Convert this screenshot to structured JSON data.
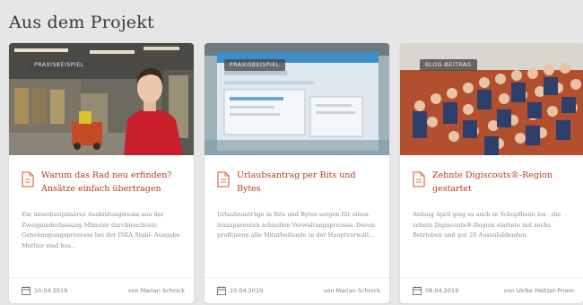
{
  "section": {
    "title": "Aus dem Projekt"
  },
  "cards": [
    {
      "badge": "Praxisbeispiel",
      "title": "Warum das Rad neu erfinden? Ansätze einfach übertragen",
      "text": "Ein interdisziplinäres Ausbildungsteam aus der Zweigniederlassung Münster durchleuchtete Genehmigungsprozesse bei der ISKA Stahl- Ausgabe Mettler sind bes…",
      "date": "10.04.2019",
      "author": "von Marian Schnick",
      "icon": "document-icon"
    },
    {
      "badge": "Praxisbeispiel",
      "title": "Urlaubsantrag per Bits und Bytes",
      "text": "Urlaubsanträge in Bits und Bytes sorgen für einen transparenten schnellen Verwaltungsprozess. Davon profitieren alle Mitarbeitende in der Hauptverwalt…",
      "date": "10.04.2019",
      "author": "von Marian Schnick",
      "icon": "document-icon"
    },
    {
      "badge": "Blog-Beitrag",
      "title": "Zehnte Digiscouts®-Region gestartet",
      "text": "Anfang April ging es auch in Schopfheim los - die zehnte Digiscouts®-Region startete mit sechs Betrieben und gut 20 Auszubildenden.",
      "date": "08.04.2019",
      "author": "von Ulrike Heitzer-Priem",
      "icon": "document-icon"
    }
  ],
  "colors": {
    "accent": "#b33a1e",
    "background": "#e6e6e6",
    "card": "#ffffff"
  }
}
